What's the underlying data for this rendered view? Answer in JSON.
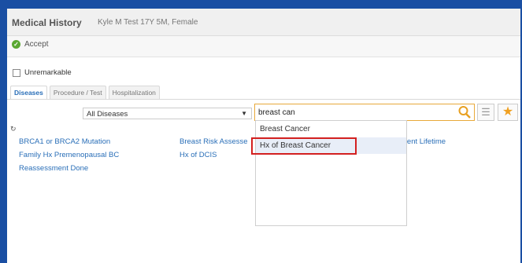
{
  "header": {
    "title": "Medical History",
    "patient": "Kyle M Test 17Y 5M, Female"
  },
  "toolbar": {
    "accept_label": "Accept"
  },
  "unremarkable_label": "Unremarkable",
  "tabs": [
    {
      "label": "Diseases",
      "active": true
    },
    {
      "label": "Procedure / Test",
      "active": false
    },
    {
      "label": "Hospitalization",
      "active": false
    }
  ],
  "filter": {
    "selected": "All Diseases"
  },
  "search": {
    "value": "breast can"
  },
  "results": {
    "col1": [
      "BRCA1 or BRCA2 Mutation",
      "Family Hx Premenopausal BC",
      "Reassessment Done"
    ],
    "col2": [
      "Breast Risk Assesse",
      "Hx of DCIS"
    ],
    "col3": [
      "ment Lifetime"
    ]
  },
  "dropdown": {
    "items": [
      "Breast Cancer",
      "Hx of Breast Cancer"
    ],
    "highlighted_index": 1
  },
  "colors": {
    "frame": "#1a4fa3",
    "link": "#2a6fb8",
    "accent": "#e8a020",
    "highlight_box": "#d32020"
  },
  "icons": {
    "accept": "check-circle-icon",
    "search": "search-icon",
    "list": "list-icon",
    "favorite": "star-icon",
    "refresh": "refresh-icon",
    "filter": "chevron-down-icon"
  }
}
